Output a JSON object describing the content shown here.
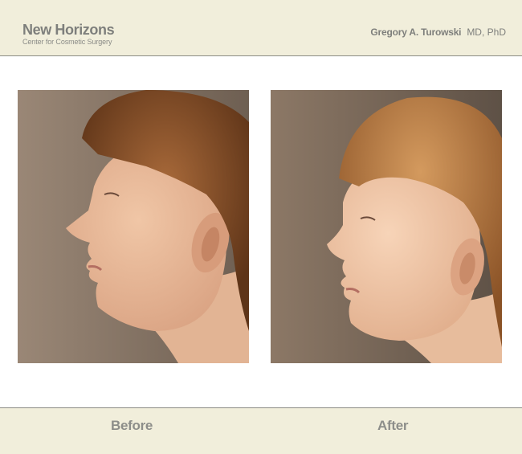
{
  "header": {
    "brand_name": "New Horizons",
    "brand_tagline": "Center for Cosmetic Surgery",
    "doctor_name": "Gregory A. Turowski",
    "doctor_credentials": "MD, PhD"
  },
  "photos": {
    "before": {
      "icon": "before-profile-photo"
    },
    "after": {
      "icon": "after-profile-photo"
    }
  },
  "footer": {
    "before_label": "Before",
    "after_label": "After"
  },
  "colors": {
    "header_bg": "#f1eedb",
    "text_gray": "#7e7f7c",
    "rule": "#8b8b84"
  }
}
